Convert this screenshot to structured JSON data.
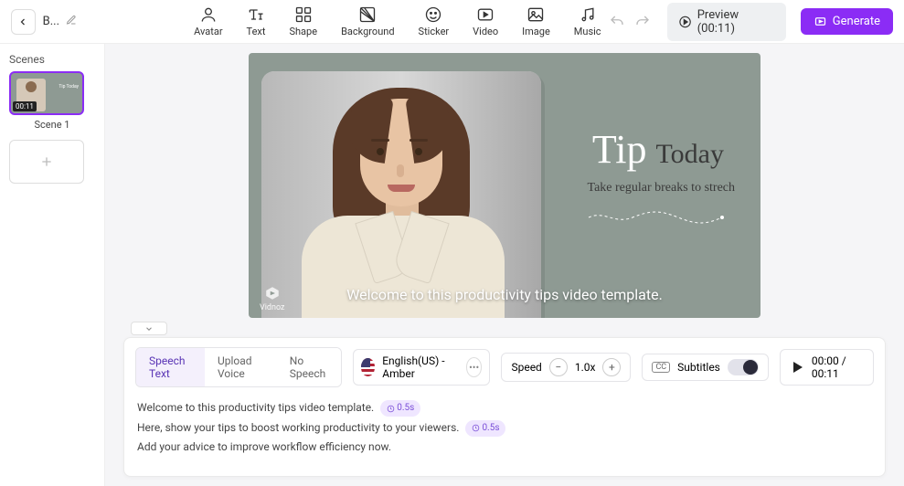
{
  "header": {
    "title_short": "B...",
    "tools": [
      {
        "name": "avatar",
        "label": "Avatar"
      },
      {
        "name": "text",
        "label": "Text"
      },
      {
        "name": "shape",
        "label": "Shape"
      },
      {
        "name": "background",
        "label": "Background"
      },
      {
        "name": "sticker",
        "label": "Sticker"
      },
      {
        "name": "video",
        "label": "Video"
      },
      {
        "name": "image",
        "label": "Image"
      },
      {
        "name": "music",
        "label": "Music"
      }
    ],
    "preview_label": "Preview (00:11)",
    "generate_label": "Generate"
  },
  "sidebar": {
    "title": "Scenes",
    "scene_duration": "00:11",
    "scene_label": "Scene 1",
    "thumb_mini_text": "Tip Today"
  },
  "canvas": {
    "title_script": "Tip",
    "title_serif": "Today",
    "subtitle": "Take regular breaks to strech",
    "watermark": "Vidnoz",
    "caption": "Welcome to this productivity tips video template."
  },
  "controls": {
    "tabs": {
      "speech": "Speech Text",
      "upload": "Upload Voice",
      "none": "No Speech"
    },
    "voice_label": "English(US) - Amber",
    "speed_label": "Speed",
    "speed_value": "1.0x",
    "subtitles_label": "Subtitles",
    "time_display": "00:00 / 00:11"
  },
  "script": {
    "line1": "Welcome to this productivity tips video template.",
    "dur1": "0.5s",
    "line2": "Here, show your tips to boost working productivity to your viewers.",
    "dur2": "0.5s",
    "line3": "Add your advice to improve workflow efficiency now."
  }
}
